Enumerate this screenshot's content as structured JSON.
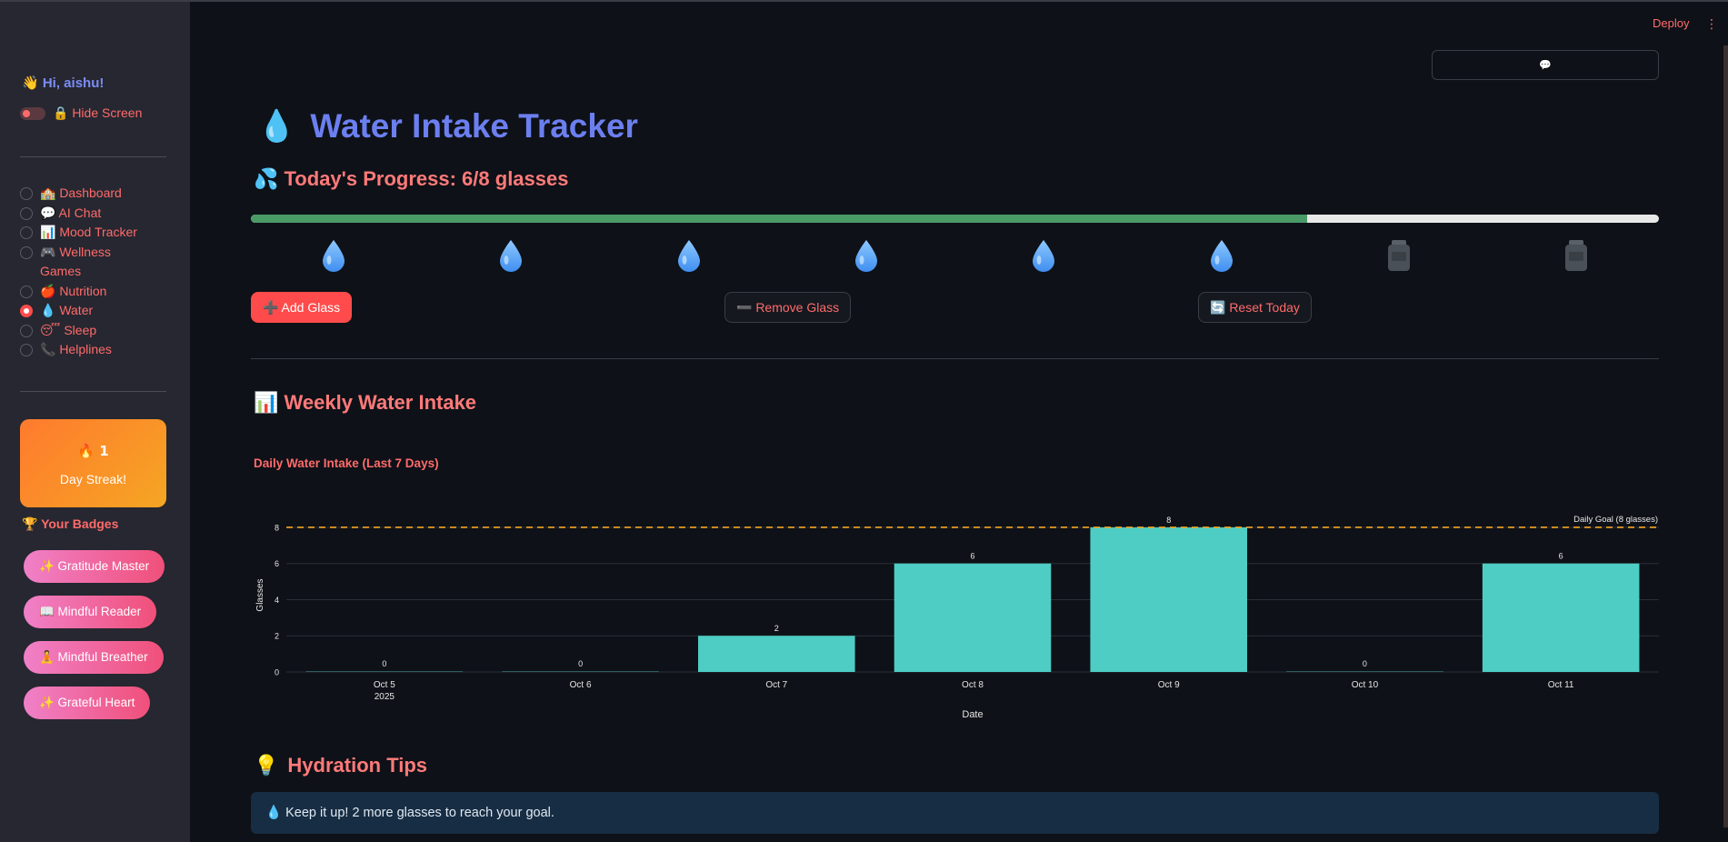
{
  "sidebar": {
    "greeting": "👋 Hi, aishu!",
    "hide_screen": "🔒 Hide Screen",
    "nav": [
      {
        "label": "🏫 Dashboard",
        "selected": false
      },
      {
        "label": "💬 AI Chat",
        "selected": false
      },
      {
        "label": "📊 Mood Tracker",
        "selected": false
      },
      {
        "label": "🎮 Wellness Games",
        "selected": false
      },
      {
        "label": "🍎 Nutrition",
        "selected": false
      },
      {
        "label": "💧 Water",
        "selected": true
      },
      {
        "label": "😴 Sleep",
        "selected": false
      },
      {
        "label": "📞 Helplines",
        "selected": false
      }
    ],
    "streak_number": "🔥 1",
    "streak_label": "Day Streak!",
    "badges_heading": "🏆 Your Badges",
    "badges": [
      "✨ Gratitude Master",
      "📖 Mindful Reader",
      "🧘 Mindful Breather",
      "✨ Grateful Heart"
    ]
  },
  "header": {
    "deploy": "Deploy",
    "menu_icon": "⋮",
    "chat_icon": "💬"
  },
  "main": {
    "title_icon": "💧",
    "title": "Water Intake Tracker",
    "progress_heading": "💦 Today's Progress: 6/8 glasses",
    "progress_fraction": 0.75,
    "glasses": {
      "filled": 6,
      "total": 8,
      "filled_icon": "water-drop-icon",
      "empty_icon": "empty-jar-icon"
    },
    "buttons": {
      "add": "➕ Add Glass",
      "remove": "➖ Remove Glass",
      "reset": "🔄 Reset Today"
    },
    "weekly_heading": "📊 Weekly Water Intake",
    "tips_heading_icon": "💡",
    "tips_heading": "Hydration Tips",
    "tip": "💧 Keep it up! 2 more glasses to reach your goal."
  },
  "chart_data": {
    "type": "bar",
    "title": "Daily Water Intake (Last 7 Days)",
    "xlabel": "Date",
    "ylabel": "Glasses",
    "categories": [
      "Oct 5\n2025",
      "Oct 6",
      "Oct 7",
      "Oct 8",
      "Oct 9",
      "Oct 10",
      "Oct 11"
    ],
    "values": [
      0,
      0,
      2,
      6,
      8,
      0,
      6
    ],
    "ylim": [
      0,
      8.5
    ],
    "yticks": [
      0,
      2,
      4,
      6,
      8
    ],
    "goal_line": {
      "value": 8,
      "label": "Daily Goal (8 glasses)"
    },
    "grid": true,
    "colors": {
      "bar": "#4ecdc4",
      "goal": "#f5a623"
    }
  }
}
